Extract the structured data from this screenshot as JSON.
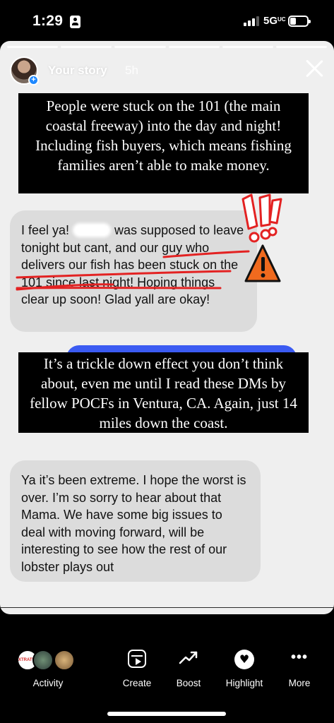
{
  "status_bar": {
    "time": "1:29",
    "network": "5G",
    "network_suffix": "UC"
  },
  "story": {
    "user": "Your story",
    "age": "5h",
    "caption_top": "People were stuck on the 101 (the main coastal freeway) into the day and night! Including fish buyers, which means fishing families aren’t able to make money.",
    "caption_middle": "It’s a trickle down effect you don’t think about, even me until I read these DMs by fellow POCFs in Ventura, CA. Again, just 14 miles down the coast.",
    "dm_1": {
      "part_before": "I feel ya! ",
      "part_after": " was supposed to leave tonight but cant, and our guy who delivers our fish has been stuck on the 101 since last night! Hoping things clear up soon! Glad yall are okay!"
    },
    "dm_2": "Ya it’s been extreme. I hope the worst is over. I’m so sorry to hear about that Mama. We have some big issues to deal with moving forward, will be interesting to see how the rest of our lobster plays out"
  },
  "bottom_bar": {
    "activity": "Activity",
    "create": "Create",
    "boost": "Boost",
    "highlight": "Highlight",
    "more": "More",
    "viewer_badge": "XTRATUF"
  },
  "colors": {
    "accent_blue": "#3b5bf2",
    "annotation_red": "#e32222",
    "warning_orange": "#f06a1e"
  }
}
